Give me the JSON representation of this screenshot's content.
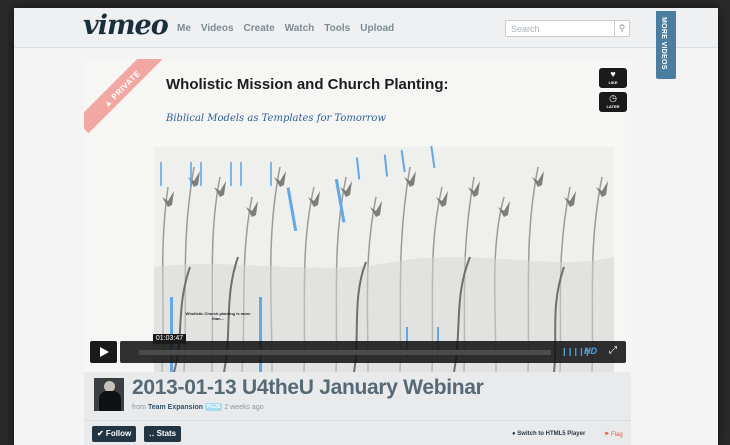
{
  "brand": {
    "logo": "vimeo"
  },
  "nav": [
    "Me",
    "Videos",
    "Create",
    "Watch",
    "Tools",
    "Upload"
  ],
  "search": {
    "placeholder": "Search"
  },
  "more_videos_label": "MORE VIDEOS",
  "player": {
    "private_label": "▲ PRIVATE",
    "slide_title": "Wholistic Mission and Church Planting:",
    "slide_subtitle": "Biblical Models as Templates for Tomorrow",
    "slide_note": "Wholistic Church planting is more than...",
    "like_label": "LIKE",
    "later_label": "LATER",
    "timecode": "01:03:47",
    "hd_label": "HD"
  },
  "video": {
    "title": "2013-01-13 U4theU January Webinar",
    "from_label": "from",
    "owner": "Team Expansion",
    "badge": "PLUS",
    "age": "2 weeks ago"
  },
  "actions": {
    "follow": "✔ Follow",
    "stats": "‥ Stats",
    "switch_player": "● Switch to HTML5 Player",
    "flag": "⚑ Flag"
  },
  "colors": {
    "accent": "#47a7e3",
    "dark_button": "#233443",
    "private_ribbon": "#f2a8a2",
    "more_videos": "#4a7d9f"
  }
}
